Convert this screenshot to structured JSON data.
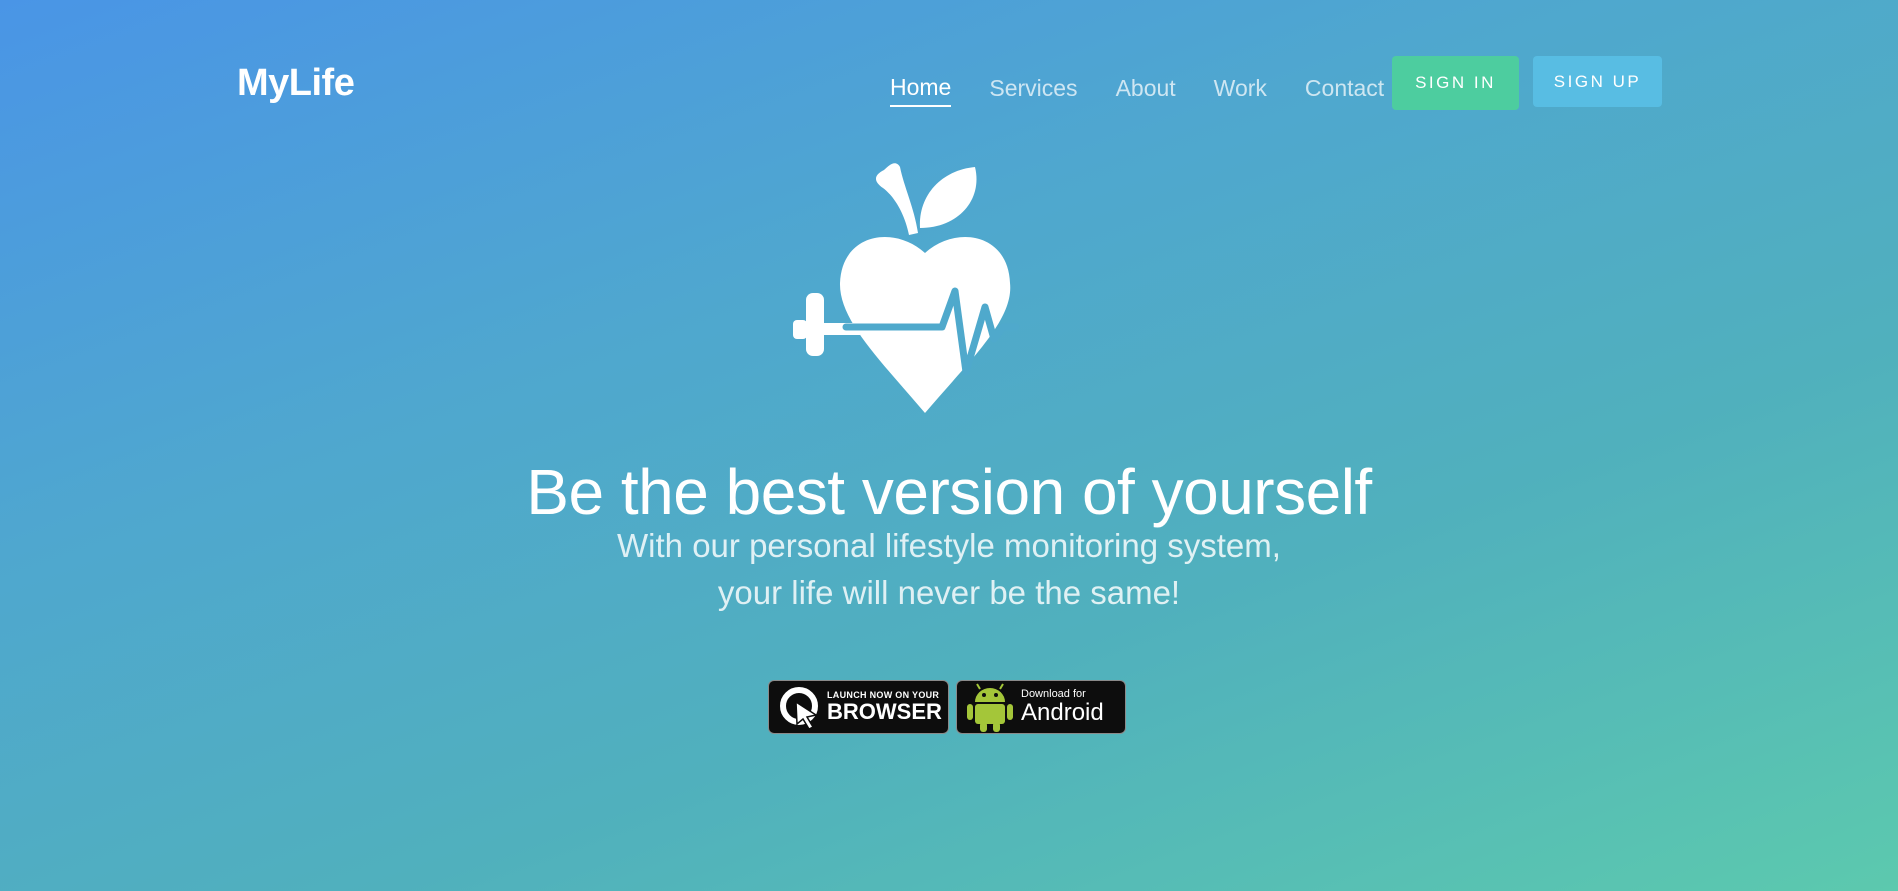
{
  "header": {
    "logo": "MyLife",
    "nav": [
      {
        "label": "Home",
        "active": true
      },
      {
        "label": "Services",
        "active": false
      },
      {
        "label": "About",
        "active": false
      },
      {
        "label": "Work",
        "active": false
      },
      {
        "label": "Contact",
        "active": false
      }
    ],
    "sign_in": "SIGN IN",
    "sign_up": "SIGN UP"
  },
  "hero": {
    "logo_icon": "apple-heart-heartbeat-dumbbell-icon",
    "headline": "Be the best version of yourself",
    "subline1": "With our personal lifestyle monitoring system,",
    "subline2": "your life will never be the same!"
  },
  "badges": {
    "browser_small": "LAUNCH NOW ON YOUR",
    "browser_big": "BROWSER",
    "android_small": "Download for",
    "android_big": "Android"
  },
  "colors": {
    "sign_in_bg": "#4dcd9f",
    "sign_up_bg": "#58bde3",
    "heartbeat_line": "#4fa9cc",
    "android_green": "#a4c639"
  }
}
